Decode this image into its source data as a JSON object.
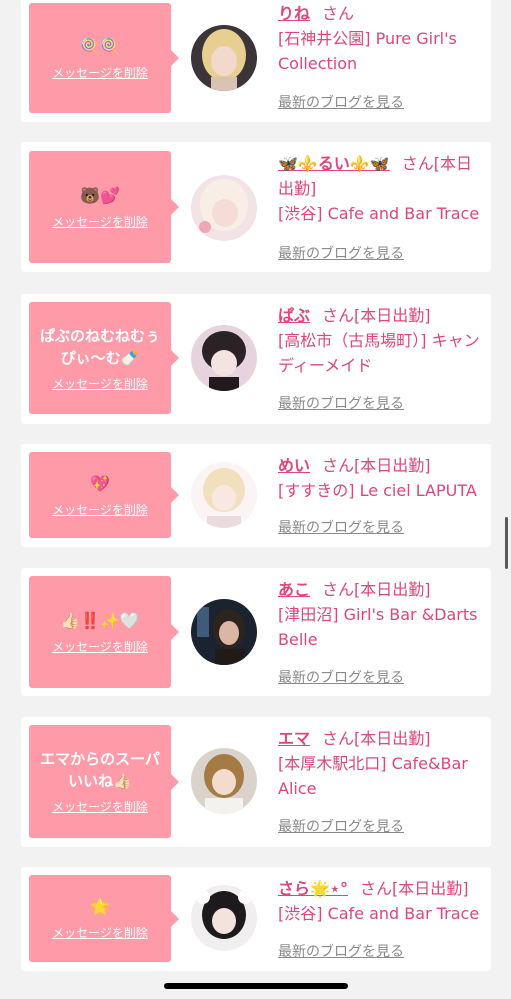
{
  "delete_label": "メッセージを削除",
  "blog_label": "最新のブログを見る",
  "san_label": "さん",
  "colors": {
    "accent": "#e0457b",
    "bubble": "#ff9aa9",
    "link_gray": "#8a8a8a"
  },
  "cards": [
    {
      "message": "🍭🍭",
      "name": "りね",
      "suffix": "さん",
      "shop": "[石神井公園] Pure Girl's Collection"
    },
    {
      "message": "🐻💕",
      "name": "🦋⚜️るい⚜️🦋",
      "suffix": "さん[本日出勤]",
      "shop": "[渋谷] Cafe and Bar Trace"
    },
    {
      "message": "ぱぶのねむねむぅ\nぴぃ〜む🍼",
      "name": "ぱぶ",
      "suffix": "さん[本日出勤]",
      "shop": "[高松市（古馬場町）] キャンディーメイド"
    },
    {
      "message": "💖",
      "name": "めい",
      "suffix": "さん[本日出勤]",
      "shop": "[すすきの] Le ciel LAPUTA"
    },
    {
      "message": "👍🏻‼️✨🤍",
      "name": "あこ",
      "suffix": "さん[本日出勤]",
      "shop": "[津田沼] Girl's Bar &Darts Belle"
    },
    {
      "message": "エマからのスーパ\nいいね👍🏻",
      "name": "エマ",
      "suffix": "さん[本日出勤]",
      "shop": "[本厚木駅北口] Cafe&Bar Alice"
    },
    {
      "message": "🌟",
      "name": "さら🌟⋆°",
      "suffix": "さん[本日出勤]",
      "shop": "[渋谷] Cafe and Bar Trace"
    }
  ]
}
